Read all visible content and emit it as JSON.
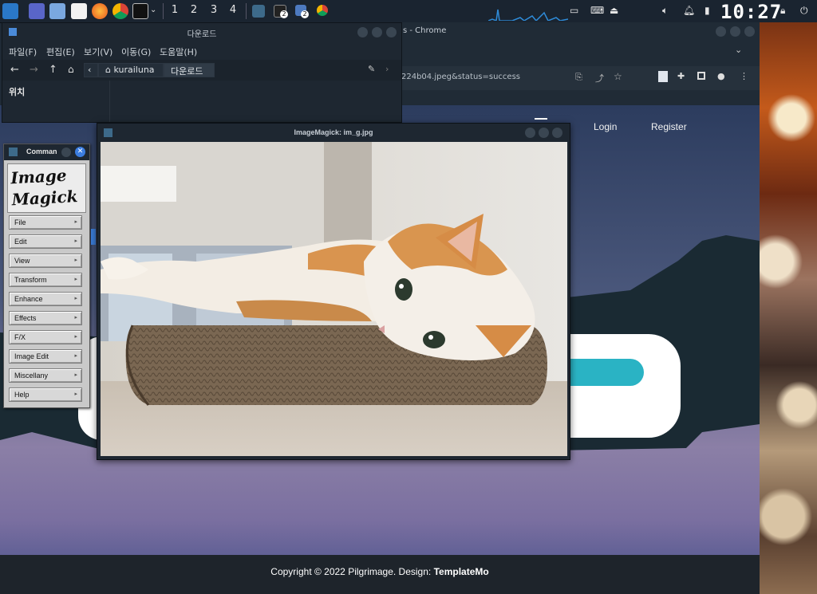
{
  "taskbar": {
    "workspaces": [
      "1",
      "2",
      "3",
      "4"
    ],
    "badges": [
      "2",
      "2"
    ],
    "clock": "10:27"
  },
  "file_manager": {
    "title": "다운로드",
    "menu": [
      "파일(F)",
      "편집(E)",
      "보기(V)",
      "이동(G)",
      "도움말(H)"
    ],
    "breadcrumb": [
      "kurailuna",
      "다운로드"
    ],
    "sidebar_heading": "위치"
  },
  "chrome": {
    "title": "s - Chrome",
    "url": "224b04.jpeg&status=success"
  },
  "website": {
    "nav": [
      "Login",
      "Register"
    ],
    "footer_prefix": "Copyright © 2022 Pilgrimage. Design: ",
    "footer_brand": "TemplateMo",
    "accent": "#2ab3c4"
  },
  "imagemagick_command": {
    "title": "Comman",
    "logo_line1": "Image",
    "logo_line2": "Magick",
    "buttons": [
      "File",
      "Edit",
      "View",
      "Transform",
      "Enhance",
      "Effects",
      "F/X",
      "Image Edit",
      "Miscellany",
      "Help"
    ]
  },
  "image_viewer": {
    "title": "ImageMagick: im_g.jpg"
  }
}
